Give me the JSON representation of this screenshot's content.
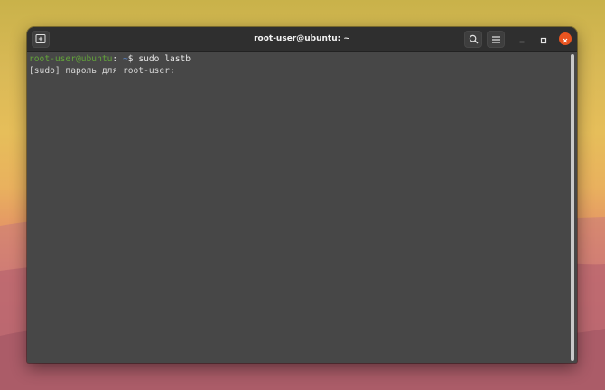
{
  "window": {
    "title": "root-user@ubuntu: ~"
  },
  "icons": {
    "new_tab": "new-tab-icon",
    "search": "search-icon",
    "menu": "hamburger-menu-icon",
    "minimize": "minimize-icon",
    "maximize": "maximize-icon",
    "close": "close-icon"
  },
  "colors": {
    "prompt_user": "#62a33a",
    "prompt_path": "#5b8ad4",
    "close_button": "#e95420",
    "terminal_bg": "#474747"
  },
  "terminal": {
    "prompt_user_host": "root-user@ubuntu",
    "prompt_colon": ":",
    "prompt_path": " ~",
    "prompt_symbol": "$ ",
    "command": "sudo lastb",
    "output_line": "[sudo] пароль для root-user:"
  }
}
